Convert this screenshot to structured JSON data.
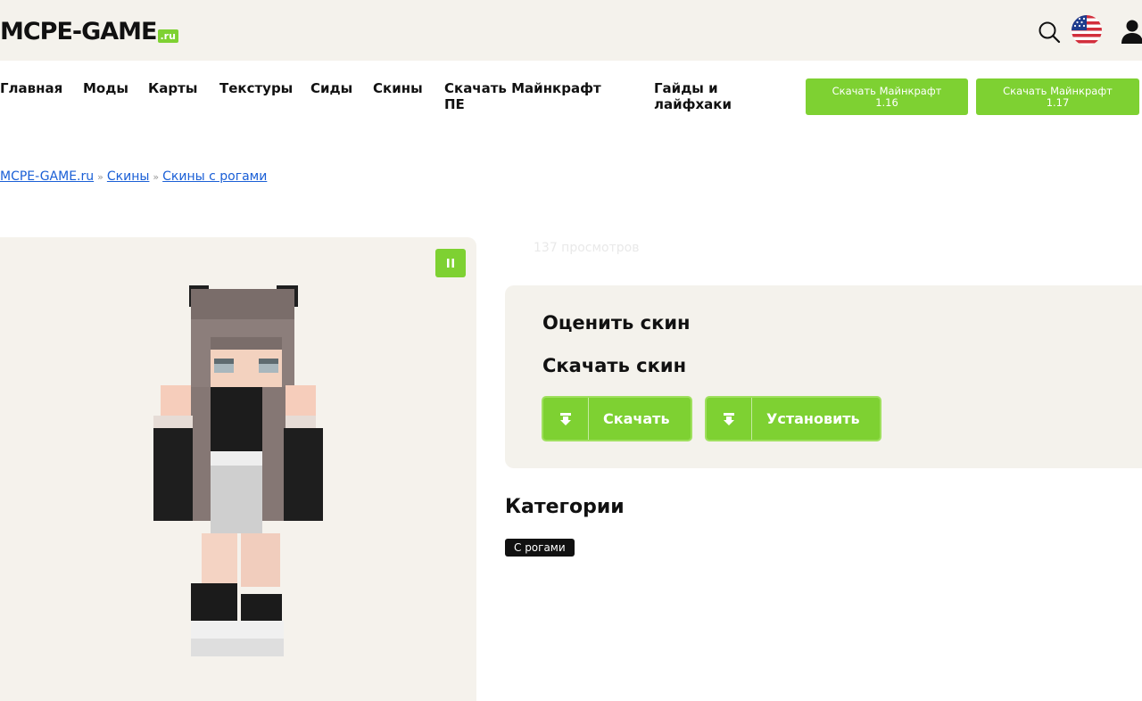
{
  "header": {
    "logo_main": "MCPE-GAME",
    "logo_suffix": ".ru"
  },
  "nav": [
    {
      "label": "Главная"
    },
    {
      "label": "Моды"
    },
    {
      "label": "Карты"
    },
    {
      "label": "Текстуры"
    },
    {
      "label": "Сиды"
    },
    {
      "label": "Скины"
    },
    {
      "label_line1": "Скачать Майнкрафт",
      "label_line2": "ПЕ"
    },
    {
      "label_line1": "Гайды и",
      "label_line2": "лайфхаки"
    }
  ],
  "download_buttons": [
    {
      "line1": "Скачать Майнкрафт",
      "line2": "1.16"
    },
    {
      "line1": "Скачать Майнкрафт",
      "line2": "1.17"
    }
  ],
  "breadcrumb": {
    "items": [
      "MCPE-GAME.ru",
      "Скины",
      "Скины с рогами"
    ],
    "separator": "»"
  },
  "views": "137 просмотров",
  "rate_heading": "Оценить скин",
  "download_heading": "Скачать скин",
  "actions": {
    "download_label": "Скачать",
    "install_label": "Установить"
  },
  "categories": {
    "heading": "Категории",
    "tags": [
      "С рогами"
    ]
  },
  "colors": {
    "brand_green": "#7ed132",
    "header_bg": "#f4f2ec",
    "link_blue": "#1a5fd6"
  }
}
